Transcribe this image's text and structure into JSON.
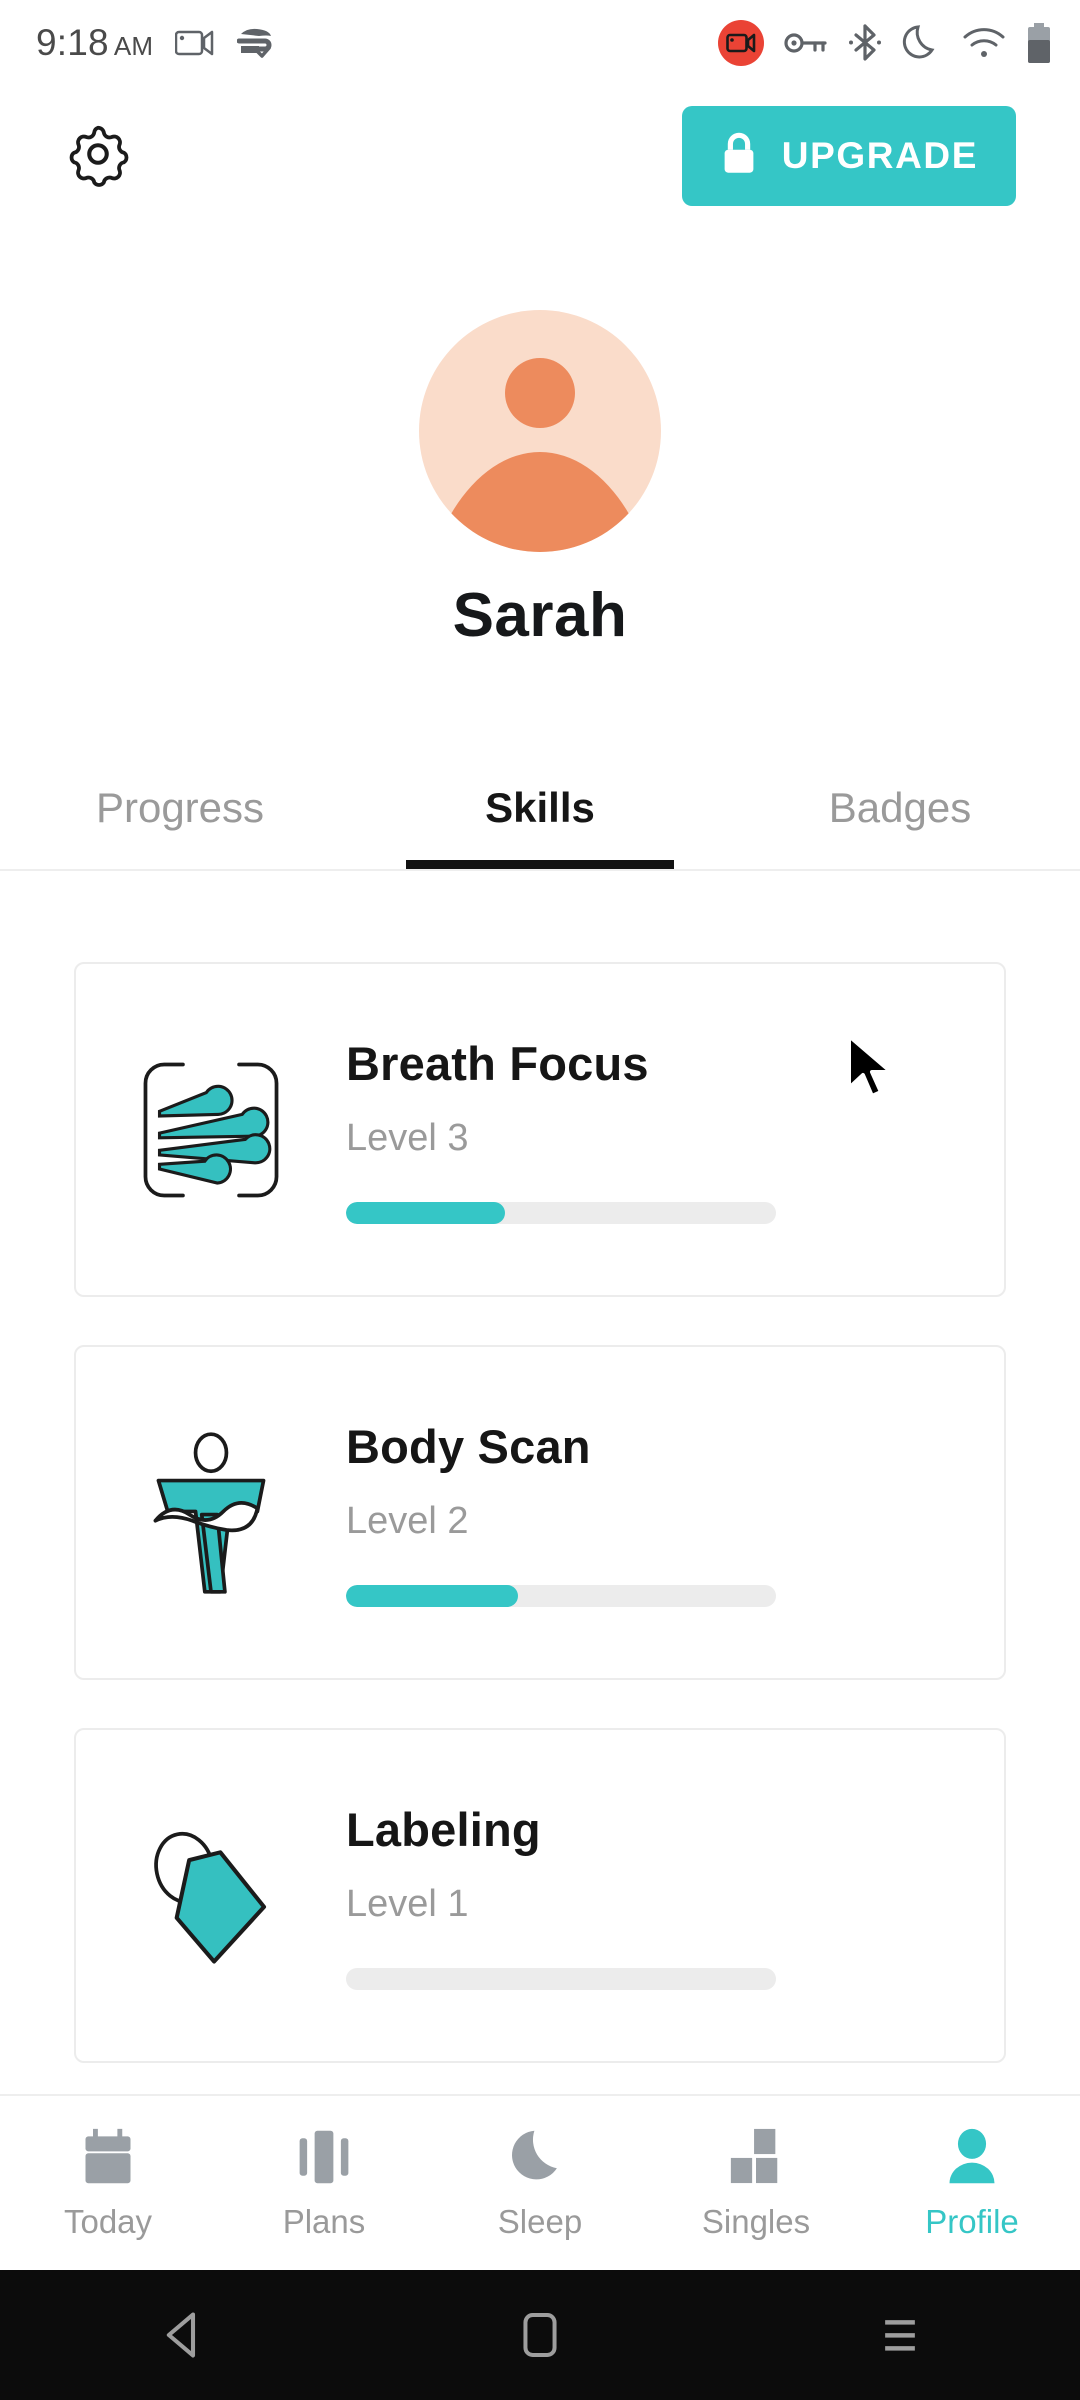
{
  "status_bar": {
    "time": "9:18",
    "meridiem": "AM",
    "icons": [
      {
        "name": "video-camera-icon"
      },
      {
        "name": "data-saver-check-icon"
      },
      {
        "name": "screen-record-icon"
      },
      {
        "name": "vpn-key-icon"
      },
      {
        "name": "bluetooth-icon"
      },
      {
        "name": "do-not-disturb-moon-icon"
      },
      {
        "name": "wifi-icon"
      },
      {
        "name": "battery-icon"
      }
    ]
  },
  "header": {
    "settings_icon": "gear-icon",
    "upgrade_label": "UPGRADE",
    "upgrade_icon": "lock-icon",
    "upgrade_color": "#35c6c6"
  },
  "profile": {
    "name": "Sarah",
    "avatar_bg": "#fadcca",
    "avatar_fg": "#ed8b5d"
  },
  "tabs": [
    {
      "label": "Progress",
      "active": false
    },
    {
      "label": "Skills",
      "active": true
    },
    {
      "label": "Badges",
      "active": false
    }
  ],
  "skills": [
    {
      "icon": "breath-focus-icon",
      "title": "Breath Focus",
      "level": "Level 3",
      "progress_percent": 37
    },
    {
      "icon": "body-scan-icon",
      "title": "Body Scan",
      "level": "Level 2",
      "progress_percent": 40
    },
    {
      "icon": "labeling-tag-icon",
      "title": "Labeling",
      "level": "Level 1",
      "progress_percent": 0
    }
  ],
  "bottom_nav": [
    {
      "label": "Today",
      "icon": "calendar-icon",
      "active": false
    },
    {
      "label": "Plans",
      "icon": "bars-icon",
      "active": false
    },
    {
      "label": "Sleep",
      "icon": "moon-icon",
      "active": false
    },
    {
      "label": "Singles",
      "icon": "blocks-icon",
      "active": false
    },
    {
      "label": "Profile",
      "icon": "person-icon",
      "active": true
    }
  ],
  "android_nav": [
    {
      "name": "back-button"
    },
    {
      "name": "home-button"
    },
    {
      "name": "recents-button"
    }
  ],
  "colors": {
    "accent": "#35c6c6",
    "track": "#ececec",
    "muted_text": "#9a9a9a",
    "primary_text": "#161616"
  }
}
